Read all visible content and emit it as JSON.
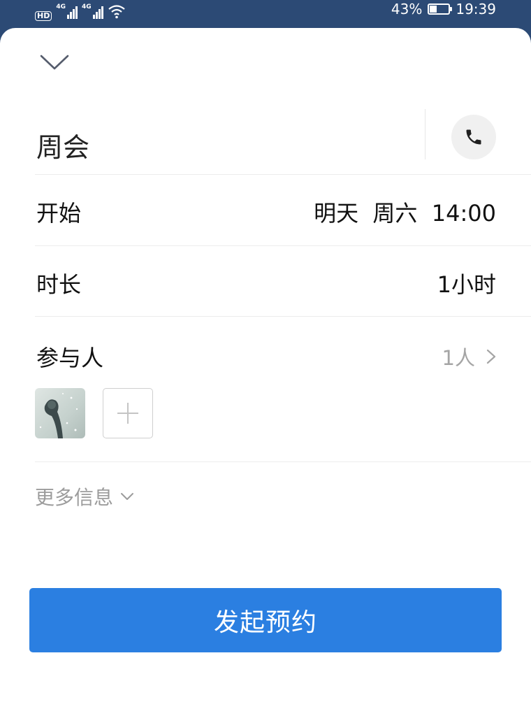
{
  "status_bar": {
    "hd_label": "HD",
    "network_1": "4G",
    "network_2": "4G",
    "battery_percent": "43%",
    "battery_level": 0.43,
    "time": "19:39"
  },
  "header": {
    "collapse_icon": "chevron-down-icon"
  },
  "meeting": {
    "title": "周会",
    "call_icon": "phone-icon"
  },
  "start": {
    "label": "开始",
    "value": "明天  周六  14:00"
  },
  "duration": {
    "label": "时长",
    "value": "1小时"
  },
  "participants": {
    "label": "参与人",
    "count": "1人",
    "add_icon": "plus-icon"
  },
  "more_info": {
    "label": "更多信息"
  },
  "submit": {
    "label": "发起预约"
  },
  "colors": {
    "status_bar_bg": "#2c4a75",
    "primary_button": "#2b7fe1",
    "muted_text": "#9c9c9c"
  }
}
